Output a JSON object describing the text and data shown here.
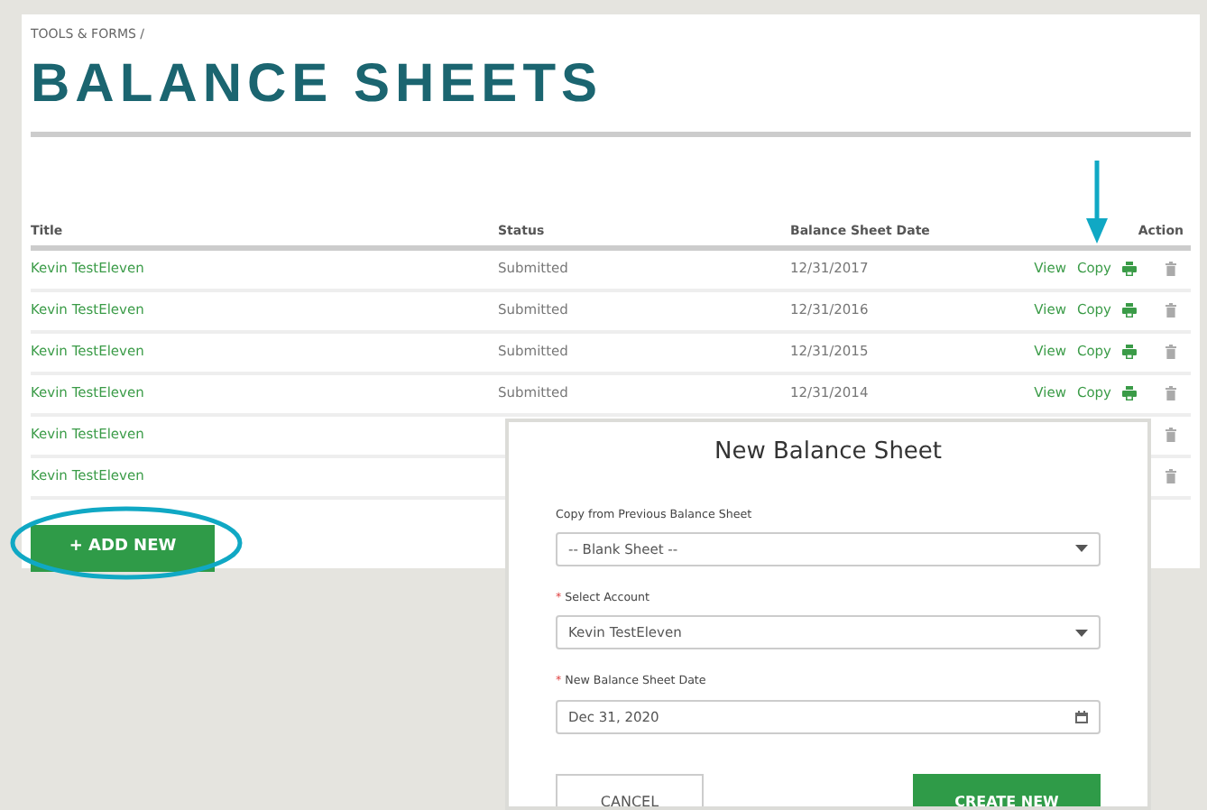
{
  "breadcrumb": "TOOLS & FORMS  /",
  "title": "BALANCE SHEETS",
  "table": {
    "columns": [
      "Title",
      "Status",
      "Balance Sheet Date",
      "Action"
    ],
    "rows": [
      {
        "title": "Kevin TestEleven",
        "status": "Submitted",
        "date": "12/31/2017",
        "actions": [
          "View",
          "Copy"
        ]
      },
      {
        "title": "Kevin TestEleven",
        "status": "Submitted",
        "date": "12/31/2016",
        "actions": [
          "View",
          "Copy"
        ]
      },
      {
        "title": "Kevin TestEleven",
        "status": "Submitted",
        "date": "12/31/2015",
        "actions": [
          "View",
          "Copy"
        ]
      },
      {
        "title": "Kevin TestEleven",
        "status": "Submitted",
        "date": "12/31/2014",
        "actions": [
          "View",
          "Copy"
        ]
      },
      {
        "title": "Kevin TestEleven"
      },
      {
        "title": "Kevin TestEleven"
      }
    ]
  },
  "add_button": "+ ADD NEW",
  "dialog": {
    "title": "New Balance Sheet",
    "fields": [
      {
        "kind": "select",
        "label": "Copy from Previous Balance Sheet",
        "value": "-- Blank Sheet --"
      },
      {
        "kind": "select",
        "label": "Select Account",
        "required_mark": "*",
        "value": "Kevin TestEleven"
      },
      {
        "kind": "date",
        "label": "New Balance Sheet Date",
        "required_mark": "*",
        "value": "Dec 31, 2020"
      }
    ],
    "cancel": "CANCEL",
    "submit": "CREATE NEW"
  }
}
